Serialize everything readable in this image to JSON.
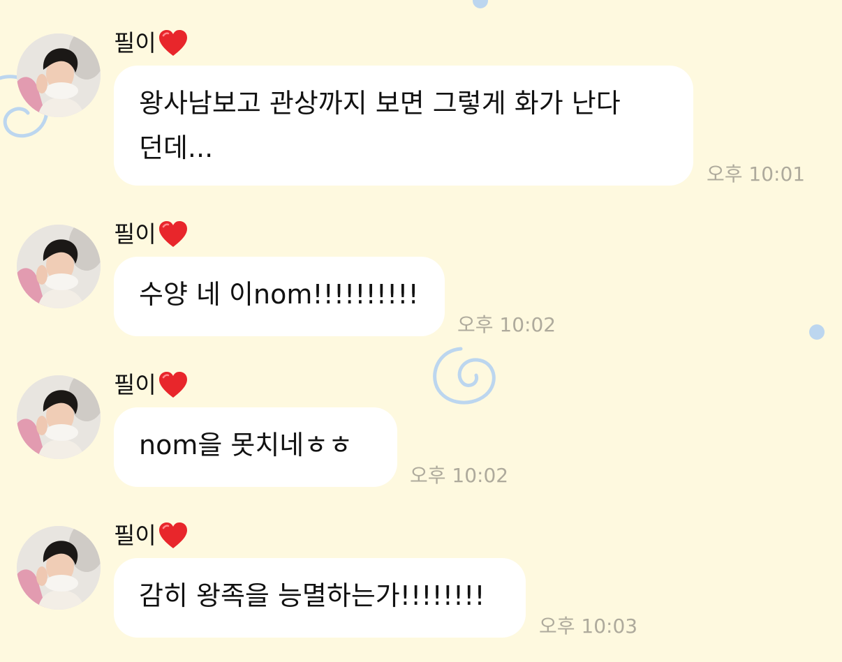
{
  "theme": {
    "background": "#fef9df",
    "bubble_background": "#ffffff",
    "timestamp_color": "#aeaa9c",
    "decoration_color": "#bcd6ef",
    "heart_color": "#e8262b"
  },
  "messages": [
    {
      "sender": "필이",
      "sender_badge_icon": "red-heart-icon",
      "avatar_icon": "profile-photo",
      "text": "왕사남보고 관상까지 보면 그렇게 화가 난다\n던데...",
      "time": "오후 10:01"
    },
    {
      "sender": "필이",
      "sender_badge_icon": "red-heart-icon",
      "avatar_icon": "profile-photo",
      "text": "수양 네 이nom!!!!!!!!!!",
      "time": "오후 10:02"
    },
    {
      "sender": "필이",
      "sender_badge_icon": "red-heart-icon",
      "avatar_icon": "profile-photo",
      "text": "nom을 못치네ㅎㅎ",
      "time": "오후 10:02"
    },
    {
      "sender": "필이",
      "sender_badge_icon": "red-heart-icon",
      "avatar_icon": "profile-photo",
      "text": "감히 왕족을 능멸하는가!!!!!!!!",
      "time": "오후 10:03"
    }
  ]
}
